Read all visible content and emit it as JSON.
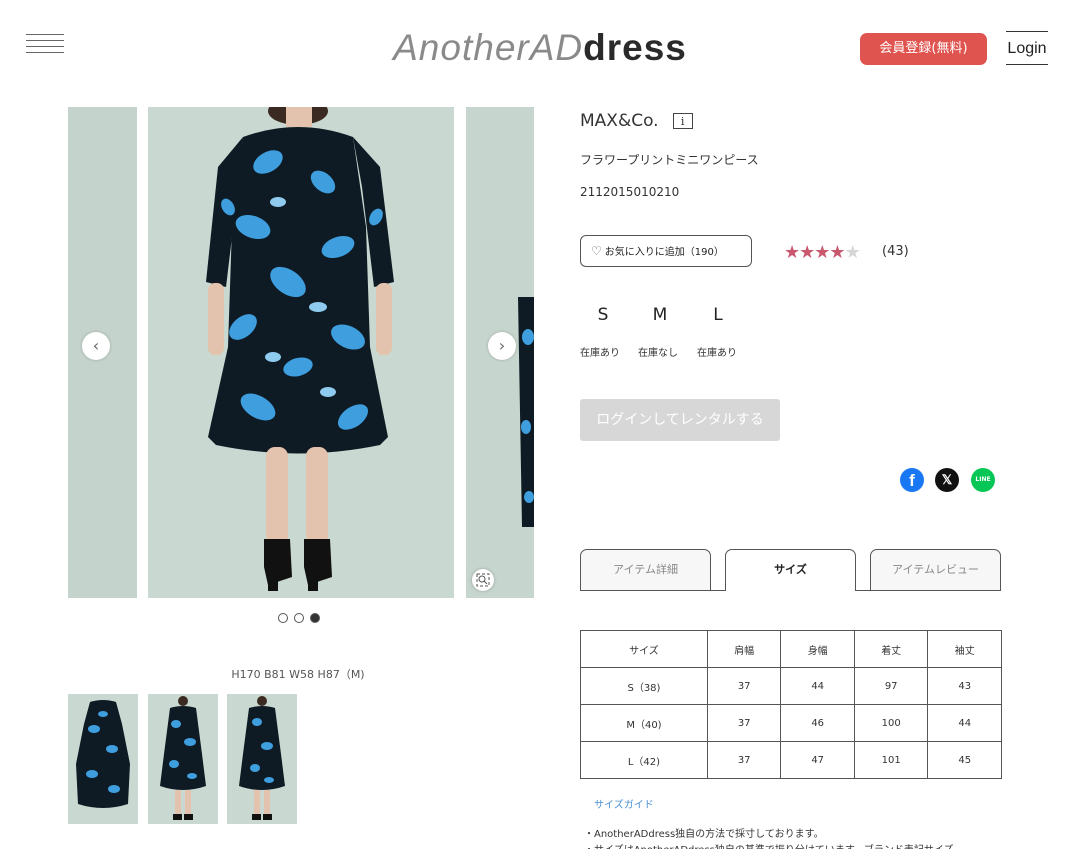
{
  "header": {
    "logo_light": "AnotherAD",
    "logo_bold": "dress",
    "register_label": "会員登録(無料)",
    "login_label": "Login"
  },
  "gallery": {
    "prev_arrow": "‹",
    "next_arrow": "›",
    "zoom_icon": "zoom-icon",
    "dot_count": 3,
    "active_dot": 3,
    "model_size": "H170 B81 W58 H87（M)",
    "thumbnail_count": 3
  },
  "product": {
    "brand": "MAX&Co.",
    "name": "フラワープリントミニワンピース",
    "code": "2112015010210",
    "favorite_label": "お気に入りに追加（190）",
    "rating_stars": 4,
    "rating_max": 5,
    "review_count": "(43)",
    "sizes": [
      {
        "label": "S",
        "stock": "在庫あり"
      },
      {
        "label": "M",
        "stock": "在庫なし"
      },
      {
        "label": "L",
        "stock": "在庫あり"
      }
    ],
    "rent_button": "ログインしてレンタルする"
  },
  "share": {
    "facebook": "f",
    "x": "𝕏",
    "line": "LINE"
  },
  "tabs": [
    {
      "label": "アイテム詳細"
    },
    {
      "label": "サイズ"
    },
    {
      "label": "アイテムレビュー"
    }
  ],
  "size_table": {
    "headers": [
      "サイズ",
      "肩幅",
      "身幅",
      "着丈",
      "袖丈"
    ],
    "rows": [
      [
        "S（38)",
        "37",
        "44",
        "97",
        "43"
      ],
      [
        "M（40)",
        "37",
        "46",
        "100",
        "44"
      ],
      [
        "L（42)",
        "37",
        "47",
        "101",
        "45"
      ]
    ]
  },
  "size_guide": {
    "link": "サイズガイド",
    "note1": "・AnotherADdress独自の方法で採寸しております。",
    "note2": "・サイズはAnotherADdress独自の基準で振り分けています。ブランド表記サイズ"
  },
  "colors": {
    "brand_red": "#e0544f",
    "star": "#c9586e",
    "link_blue": "#4a8fd1"
  }
}
